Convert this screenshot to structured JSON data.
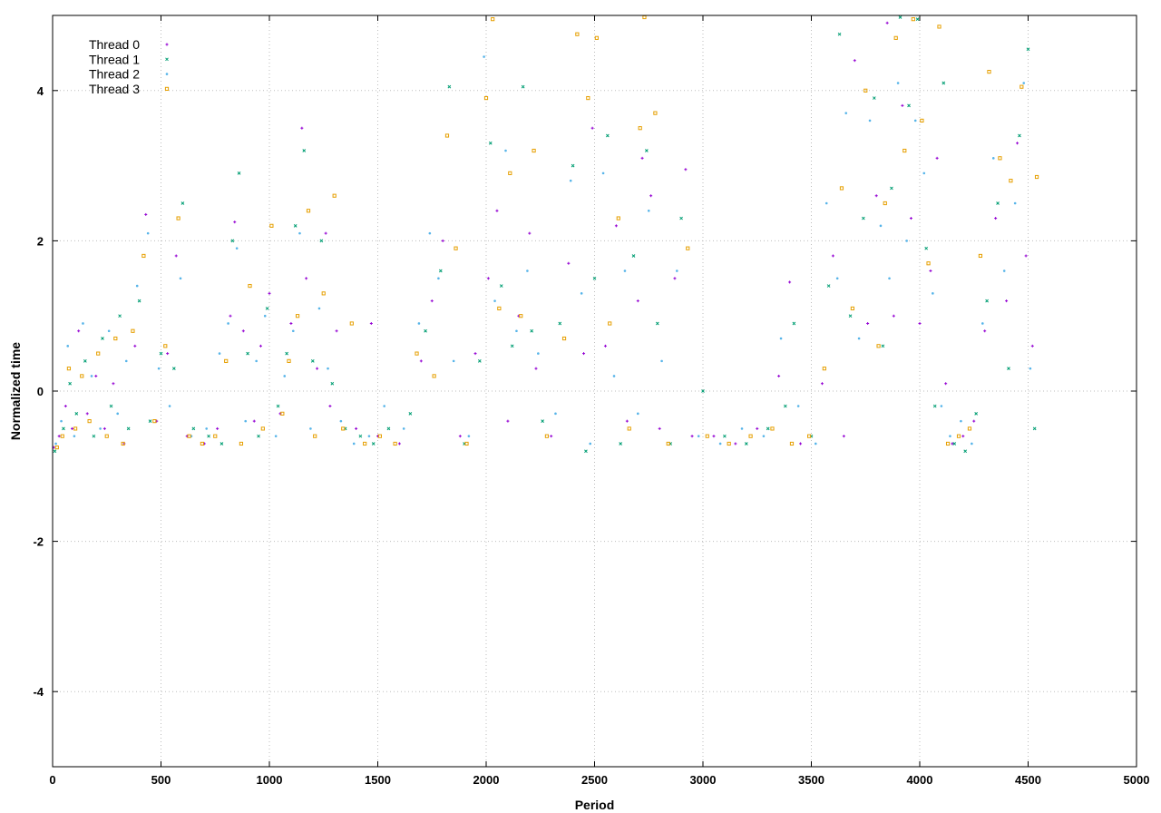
{
  "chart_data": {
    "type": "scatter",
    "title": "",
    "xlabel": "Period",
    "ylabel": "Normalized time",
    "xlim": [
      0,
      5000
    ],
    "ylim": [
      -5,
      5
    ],
    "xticks": [
      0,
      500,
      1000,
      1500,
      2000,
      2500,
      3000,
      3500,
      4000,
      4500,
      5000
    ],
    "yticks": [
      -4,
      -2,
      0,
      2,
      4
    ],
    "grid": true,
    "legend_position": "top-left",
    "series": [
      {
        "name": "Thread 0",
        "color": "#9400d3",
        "marker": "plus",
        "x": [
          5,
          30,
          60,
          90,
          120,
          160,
          200,
          240,
          280,
          330,
          380,
          430,
          480,
          530,
          570,
          620,
          700,
          760,
          820,
          840,
          880,
          930,
          960,
          1000,
          1050,
          1100,
          1150,
          1170,
          1220,
          1260,
          1280,
          1310,
          1400,
          1470,
          1500,
          1600,
          1700,
          1750,
          1800,
          1880,
          1950,
          2010,
          2050,
          2100,
          2150,
          2200,
          2230,
          2300,
          2380,
          2450,
          2490,
          2550,
          2600,
          2650,
          2700,
          2720,
          2760,
          2800,
          2870,
          2920,
          2950,
          3050,
          3150,
          3250,
          3350,
          3400,
          3450,
          3550,
          3600,
          3650,
          3700,
          3760,
          3800,
          3850,
          3880,
          3920,
          3960,
          4000,
          4050,
          4080,
          4120,
          4150,
          4200,
          4250,
          4300,
          4350,
          4400,
          4450,
          4490,
          4520
        ],
        "y": [
          -0.75,
          -0.6,
          -0.2,
          -0.5,
          0.8,
          -0.3,
          0.2,
          -0.5,
          0.1,
          -0.7,
          0.6,
          2.35,
          -0.4,
          0.5,
          1.8,
          -0.6,
          -0.7,
          -0.5,
          1.0,
          2.25,
          0.8,
          -0.4,
          0.6,
          1.3,
          -0.3,
          0.9,
          3.5,
          1.5,
          0.3,
          2.1,
          -0.2,
          0.8,
          -0.5,
          0.9,
          -0.6,
          -0.7,
          0.4,
          1.2,
          2.0,
          -0.6,
          0.5,
          1.5,
          2.4,
          -0.4,
          1.0,
          2.1,
          0.3,
          -0.6,
          1.7,
          0.5,
          3.5,
          0.6,
          2.2,
          -0.4,
          1.2,
          3.1,
          2.6,
          -0.5,
          1.5,
          2.95,
          -0.6,
          -0.6,
          -0.7,
          -0.5,
          0.2,
          1.45,
          -0.7,
          0.1,
          1.8,
          -0.6,
          4.4,
          0.9,
          2.6,
          4.9,
          1.0,
          3.8,
          2.3,
          0.9,
          1.6,
          3.1,
          0.1,
          -0.7,
          -0.6,
          -0.4,
          0.8,
          2.3,
          1.2,
          3.3,
          1.8,
          0.6
        ]
      },
      {
        "name": "Thread 1",
        "color": "#009e73",
        "marker": "cross",
        "x": [
          10,
          50,
          80,
          110,
          150,
          190,
          230,
          270,
          310,
          350,
          400,
          450,
          500,
          560,
          600,
          650,
          720,
          780,
          830,
          860,
          900,
          950,
          990,
          1040,
          1080,
          1120,
          1160,
          1200,
          1240,
          1290,
          1350,
          1420,
          1480,
          1550,
          1650,
          1720,
          1790,
          1830,
          1900,
          1970,
          2020,
          2070,
          2120,
          2170,
          2210,
          2260,
          2340,
          2400,
          2460,
          2500,
          2560,
          2620,
          2680,
          2740,
          2790,
          2850,
          2900,
          3000,
          3100,
          3200,
          3300,
          3380,
          3420,
          3500,
          3580,
          3630,
          3680,
          3740,
          3790,
          3830,
          3870,
          3910,
          3950,
          3990,
          4030,
          4070,
          4110,
          4160,
          4210,
          4260,
          4310,
          4360,
          4410,
          4460,
          4500,
          4530
        ],
        "y": [
          -0.8,
          -0.5,
          0.1,
          -0.3,
          0.4,
          -0.6,
          0.7,
          -0.2,
          1.0,
          -0.5,
          1.2,
          -0.4,
          0.5,
          0.3,
          2.5,
          -0.5,
          -0.6,
          -0.7,
          2.0,
          2.9,
          0.5,
          -0.6,
          1.1,
          -0.2,
          0.5,
          2.2,
          3.2,
          0.4,
          2.0,
          0.1,
          -0.5,
          -0.6,
          -0.7,
          -0.5,
          -0.3,
          0.8,
          1.6,
          4.05,
          -0.7,
          0.4,
          3.3,
          1.4,
          0.6,
          4.05,
          0.8,
          -0.4,
          0.9,
          3.0,
          -0.8,
          1.5,
          3.4,
          -0.7,
          1.8,
          3.2,
          0.9,
          -0.7,
          2.3,
          0.0,
          -0.6,
          -0.7,
          -0.5,
          -0.2,
          0.9,
          -0.6,
          1.4,
          4.75,
          1.0,
          2.3,
          3.9,
          0.6,
          2.7,
          5.0,
          3.8,
          4.95,
          1.9,
          -0.2,
          4.1,
          -0.7,
          -0.8,
          -0.3,
          1.2,
          2.5,
          0.3,
          3.4,
          4.55,
          -0.5
        ]
      },
      {
        "name": "Thread 2",
        "color": "#56b4e9",
        "marker": "star",
        "x": [
          15,
          40,
          70,
          100,
          140,
          180,
          220,
          260,
          300,
          340,
          390,
          440,
          490,
          540,
          590,
          640,
          710,
          770,
          810,
          850,
          890,
          940,
          980,
          1030,
          1070,
          1110,
          1140,
          1190,
          1230,
          1270,
          1330,
          1390,
          1460,
          1530,
          1620,
          1690,
          1740,
          1780,
          1850,
          1920,
          1990,
          2040,
          2090,
          2140,
          2190,
          2240,
          2320,
          2390,
          2440,
          2480,
          2540,
          2590,
          2640,
          2700,
          2750,
          2810,
          2880,
          2980,
          3080,
          3180,
          3280,
          3360,
          3440,
          3520,
          3570,
          3620,
          3660,
          3720,
          3770,
          3820,
          3860,
          3900,
          3940,
          3980,
          4020,
          4060,
          4100,
          4140,
          4190,
          4240,
          4290,
          4340,
          4390,
          4440,
          4480,
          4510
        ],
        "y": [
          -0.7,
          -0.4,
          0.6,
          -0.6,
          0.9,
          0.2,
          -0.5,
          0.8,
          -0.3,
          0.4,
          1.4,
          2.1,
          0.3,
          -0.2,
          1.5,
          -0.6,
          -0.5,
          0.5,
          0.9,
          1.9,
          -0.4,
          0.4,
          1.0,
          -0.6,
          0.2,
          0.8,
          2.1,
          -0.5,
          1.1,
          0.3,
          -0.4,
          -0.7,
          -0.6,
          -0.2,
          -0.5,
          0.9,
          2.1,
          1.5,
          0.4,
          -0.6,
          4.45,
          1.2,
          3.2,
          0.8,
          1.6,
          0.5,
          -0.3,
          2.8,
          1.3,
          -0.7,
          2.9,
          0.2,
          1.6,
          -0.3,
          2.4,
          0.4,
          1.6,
          -0.6,
          -0.7,
          -0.5,
          -0.6,
          0.7,
          -0.2,
          -0.7,
          2.5,
          1.5,
          3.7,
          0.7,
          3.6,
          2.2,
          1.5,
          4.1,
          2.0,
          3.6,
          2.9,
          1.3,
          -0.2,
          -0.6,
          -0.4,
          -0.7,
          0.9,
          3.1,
          1.6,
          2.5,
          4.1,
          0.3
        ]
      },
      {
        "name": "Thread 3",
        "color": "#e69f00",
        "marker": "box",
        "x": [
          20,
          45,
          75,
          105,
          135,
          170,
          210,
          250,
          290,
          325,
          370,
          420,
          470,
          520,
          580,
          630,
          690,
          750,
          800,
          870,
          910,
          970,
          1010,
          1060,
          1090,
          1130,
          1180,
          1210,
          1250,
          1300,
          1340,
          1380,
          1440,
          1510,
          1580,
          1680,
          1760,
          1820,
          1860,
          1910,
          2000,
          2030,
          2060,
          2110,
          2160,
          2220,
          2280,
          2360,
          2420,
          2470,
          2510,
          2570,
          2610,
          2660,
          2710,
          2730,
          2780,
          2840,
          2930,
          3020,
          3120,
          3220,
          3320,
          3410,
          3490,
          3560,
          3640,
          3690,
          3750,
          3810,
          3840,
          3890,
          3930,
          3970,
          4010,
          4040,
          4090,
          4130,
          4180,
          4230,
          4280,
          4320,
          4370,
          4420,
          4470,
          4540
        ],
        "y": [
          -0.75,
          -0.6,
          0.3,
          -0.5,
          0.2,
          -0.4,
          0.5,
          -0.6,
          0.7,
          -0.7,
          0.8,
          1.8,
          -0.4,
          0.6,
          2.3,
          -0.6,
          -0.7,
          -0.6,
          0.4,
          -0.7,
          1.4,
          -0.5,
          2.2,
          -0.3,
          0.4,
          1.0,
          2.4,
          -0.6,
          1.3,
          2.6,
          -0.5,
          0.9,
          -0.7,
          -0.6,
          -0.7,
          0.5,
          0.2,
          3.4,
          1.9,
          -0.7,
          3.9,
          4.95,
          1.1,
          2.9,
          1.0,
          3.2,
          -0.6,
          0.7,
          4.75,
          3.9,
          4.7,
          0.9,
          2.3,
          -0.5,
          3.5,
          5.0,
          3.7,
          -0.7,
          1.9,
          -0.6,
          -0.7,
          -0.6,
          -0.5,
          -0.7,
          -0.6,
          0.3,
          2.7,
          1.1,
          4.0,
          0.6,
          2.5,
          4.7,
          3.2,
          4.95,
          3.6,
          1.7,
          4.85,
          -0.7,
          -0.6,
          -0.5,
          1.8,
          4.25,
          3.1,
          2.8,
          4.05,
          2.85
        ]
      }
    ]
  }
}
